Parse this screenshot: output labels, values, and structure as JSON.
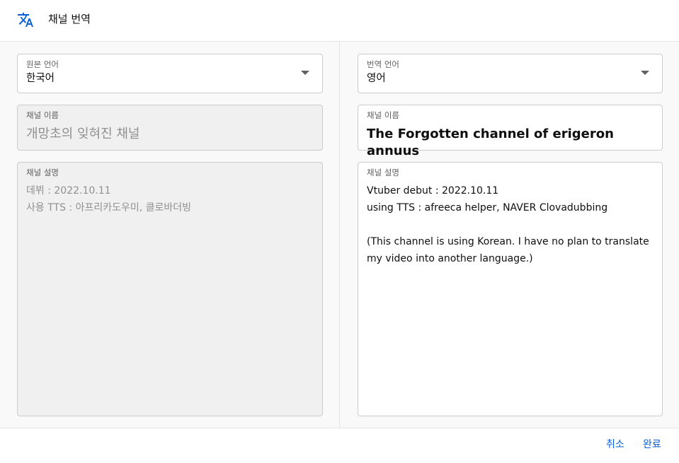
{
  "header": {
    "title": "채널 번역",
    "icon": "translate-icon"
  },
  "source": {
    "language_label": "원본 언어",
    "language_value": "한국어",
    "name_label": "채널 이름",
    "name_value": "개망초의 잊혀진 채널",
    "desc_label": "채널 설명",
    "desc_lines": [
      "데뷔 : 2022.10.11",
      "사용 TTS : 아프리카도우미, 클로바더빙"
    ]
  },
  "target": {
    "language_label": "번역 언어",
    "language_value": "영어",
    "name_label": "채널 이름",
    "name_value": "The Forgotten channel of erigeron annuus",
    "desc_label": "채널 설명",
    "desc_lines": [
      "Vtuber debut : 2022.10.11",
      "using TTS : afreeca helper, NAVER Clovadubbing",
      "",
      "(This channel is using Korean. I have no plan to translate my video into another language.)"
    ]
  },
  "footer": {
    "cancel_label": "취소",
    "done_label": "완료"
  },
  "colors": {
    "accent": "#065fd4",
    "border": "#cccccc",
    "pane_bg": "#f9f9f9"
  }
}
